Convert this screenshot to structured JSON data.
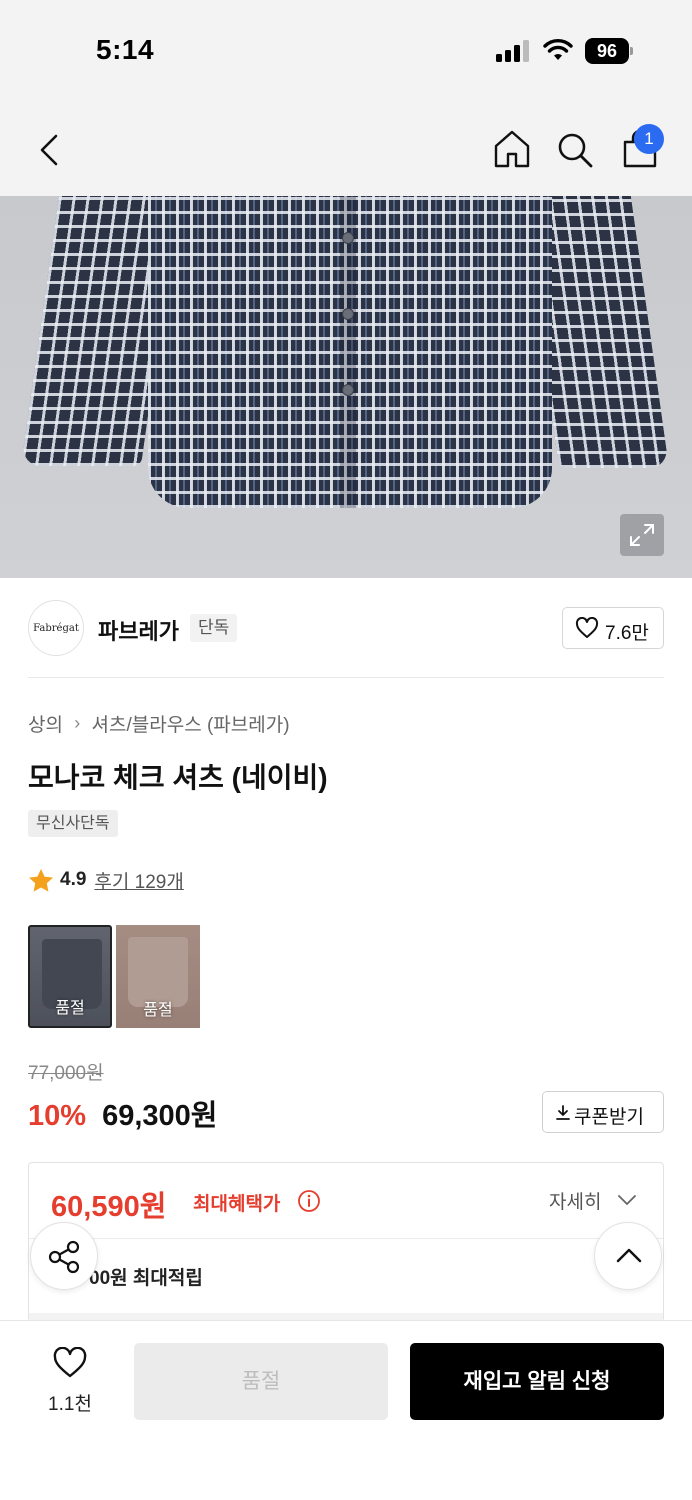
{
  "status_bar": {
    "time": "5:14",
    "battery": "96"
  },
  "nav": {
    "cart_count": "1"
  },
  "brand": {
    "logo_text": "Fabrégat",
    "name": "파브레가",
    "tag": "단독",
    "likes": "7.6만"
  },
  "breadcrumb": {
    "category": "상의",
    "subcategory": "셔츠/블라우스 (파브레가)"
  },
  "product": {
    "title": "모나코 체크 셔츠 (네이비)",
    "exclusive_badge": "무신사단독",
    "rating": "4.9",
    "review_link": "후기 129개"
  },
  "swatches": [
    {
      "label": "품절"
    },
    {
      "label": "품절"
    }
  ],
  "price": {
    "original": "77,000원",
    "discount": "10%",
    "sale": "69,300원",
    "coupon_label": "쿠폰받기"
  },
  "benefit": {
    "max_price": "60,590원",
    "max_label": "최대혜택가",
    "detail_label": "자세히",
    "points_text": "00원 최대적립"
  },
  "bottom_bar": {
    "wish_count": "1.1천",
    "soldout_label": "품절",
    "restock_label": "재입고 알림 신청"
  },
  "colors": {
    "accent_red": "#e53e2f",
    "badge_blue": "#2a6bf2",
    "primary_black": "#000000"
  }
}
